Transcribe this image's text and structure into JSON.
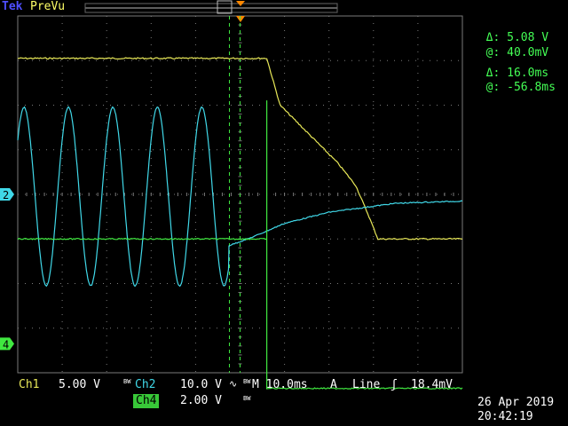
{
  "header": {
    "brand": "Tek",
    "mode": "PreVu"
  },
  "cursor_readout": {
    "amp_delta_label": "Δ:",
    "amp_delta_value": "5.08 V",
    "amp_at_label": "@:",
    "amp_at_value": "40.0mV",
    "time_delta_label": "Δ:",
    "time_delta_value": "16.0ms",
    "time_at_label": "@:",
    "time_at_value": "-56.8ms"
  },
  "markers": {
    "ch2": "2",
    "ch4": "4"
  },
  "status_bar": {
    "ch1_label": "Ch1",
    "ch1_scale": "5.00 V",
    "ch1_bw": "BW",
    "ch2_label": "Ch2",
    "ch2_scale": "10.0 V",
    "ch2_coupling": "∿",
    "ch2_bw": "BW",
    "timebase": "M 10.0ms",
    "trigger_source": "A",
    "trigger_type": "Line",
    "trigger_slope": "ʃ",
    "trigger_level": "18.4mV",
    "ch4_label": "Ch4",
    "ch4_scale": "2.00 V",
    "ch4_bw": "BW"
  },
  "timestamp": {
    "date": "26 Apr 2019",
    "time": "20:42:19"
  },
  "colors": {
    "ch1": "#e8e858",
    "ch2": "#40d8e8",
    "ch4": "#40e840",
    "grid": "#7a7a7a",
    "trigger": "#ff8800"
  },
  "chart_data": {
    "type": "line",
    "title": "",
    "xlabel": "",
    "ylabel": "",
    "x_unit": "ms",
    "xlim": [
      -50,
      50
    ],
    "ylim_divisions": [
      -4,
      4
    ],
    "grid": true,
    "series": [
      {
        "name": "Ch1",
        "values_div": [
          [
            -50,
            3.05
          ],
          [
            6,
            3.05
          ],
          [
            9,
            2.0
          ],
          [
            16,
            1.3
          ],
          [
            22,
            0.7
          ],
          [
            26,
            0.2
          ],
          [
            29,
            -0.5
          ],
          [
            31,
            -1.0
          ],
          [
            50,
            -1.0
          ]
        ]
      },
      {
        "name": "Ch2",
        "sine": {
          "x_start": -50,
          "x_end": -2.5,
          "period_ms": 10,
          "amplitude_div": 2.0,
          "offset_div": -0.05,
          "phase_ms": -48.6
        },
        "values_div": [
          [
            -2.5,
            -1.15
          ],
          [
            3,
            -0.95
          ],
          [
            10,
            -0.65
          ],
          [
            20,
            -0.4
          ],
          [
            35,
            -0.2
          ],
          [
            50,
            -0.15
          ]
        ]
      },
      {
        "name": "Ch4",
        "values_div": [
          [
            -50,
            -1.0
          ],
          [
            6,
            -1.0
          ],
          [
            6,
            -1.05
          ],
          [
            6,
            2.1
          ],
          [
            6,
            -4.35
          ],
          [
            50,
            -4.35
          ]
        ]
      }
    ]
  }
}
